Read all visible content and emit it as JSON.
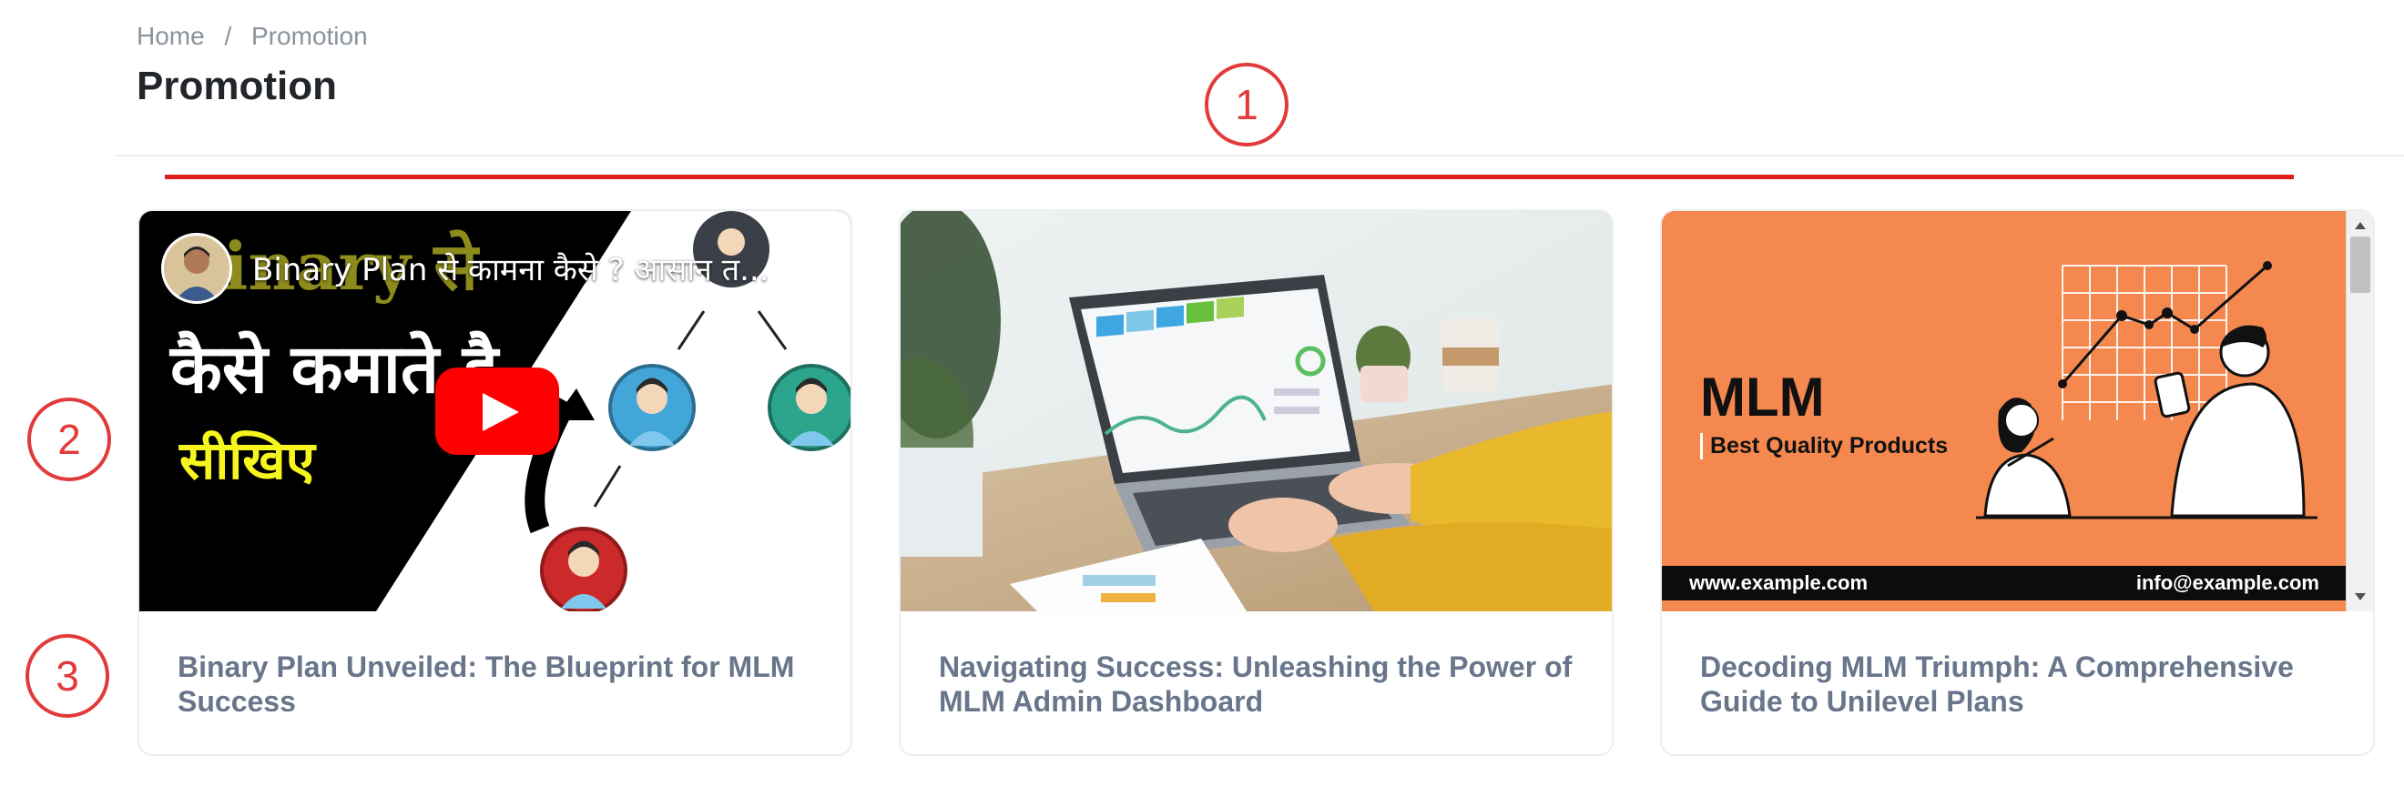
{
  "breadcrumb": {
    "home": "Home",
    "separator": "/",
    "current": "Promotion"
  },
  "page_title": "Promotion",
  "markers": [
    "1",
    "2",
    "3"
  ],
  "colors": {
    "accent_line": "#e01e1e",
    "marker": "#e23a3a",
    "card_title": "#68758a",
    "mlm_orange": "#f5884f"
  },
  "cards": [
    {
      "title": "Binary Plan Unveiled: The Blueprint for MLM Success",
      "video": {
        "title": "Binary Plan से कामना कैसे ? आसान त...",
        "overlay_word": "inary से",
        "hindi_line1": "कैसे कमाते है",
        "hindi_line2": "सीखिए",
        "play_icon": "youtube-play-icon",
        "menu_icon": "more-vert-icon"
      }
    },
    {
      "title": "Navigating Success: Unleashing the Power of MLM Admin Dashboard",
      "image": "laptop-dashboard-photo"
    },
    {
      "title": "Decoding MLM Triumph: A Comprehensive Guide to Unilevel Plans",
      "banner": {
        "heading": "MLM",
        "subheading": "Best Quality Products",
        "website": "www.example.com",
        "email": "info@example.com"
      }
    }
  ]
}
